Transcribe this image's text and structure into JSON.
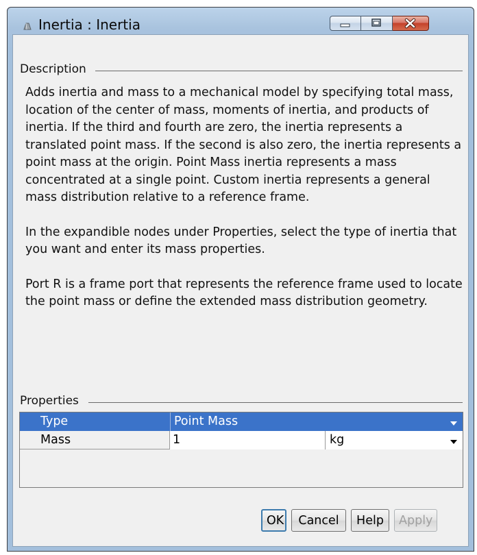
{
  "window": {
    "title": "Inertia : Inertia"
  },
  "description": {
    "label": "Description",
    "paragraphs": [
      "Adds inertia and mass to a mechanical model by specifying total mass, location of the center of mass, moments of inertia, and products of inertia. If the third and fourth are zero, the inertia represents a translated point mass. If the second is also zero, the inertia represents a point mass at the origin. Point Mass inertia represents a mass concentrated at a single point. Custom inertia represents a general mass distribution relative to a reference frame.",
      "In the expandible nodes under Properties, select the type of inertia that you want and enter its mass properties.",
      "Port R is a frame port that represents the reference frame used to locate the point mass or define the extended mass distribution geometry."
    ]
  },
  "properties": {
    "label": "Properties",
    "type_row": {
      "name": "Type",
      "value": "Point Mass"
    },
    "mass_row": {
      "name": "Mass",
      "value": "1",
      "unit": "kg"
    }
  },
  "buttons": {
    "ok": "OK",
    "cancel": "Cancel",
    "help": "Help",
    "apply": "Apply"
  },
  "colors": {
    "selection": "#3b73c9",
    "title_gradient": "#a9c3de"
  }
}
